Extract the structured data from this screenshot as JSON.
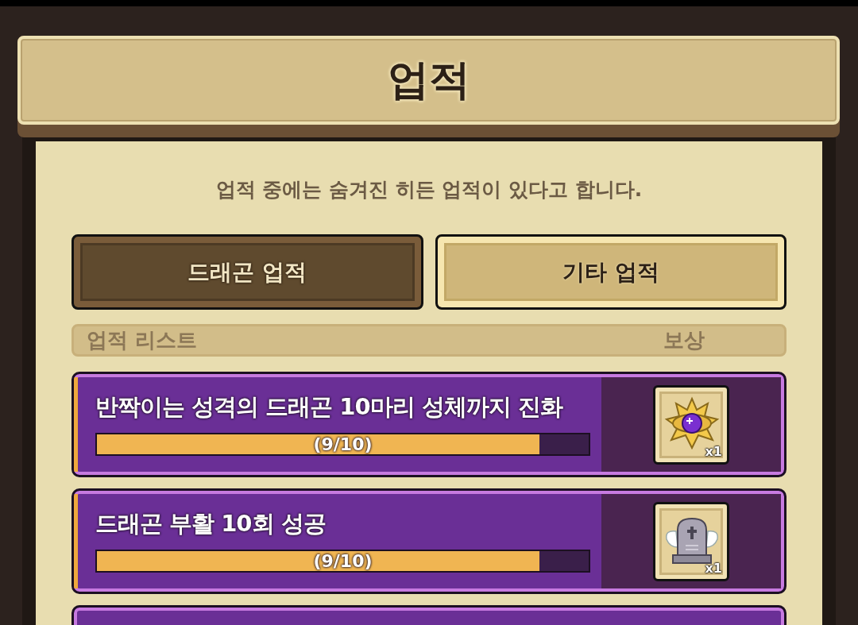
{
  "title": "업적",
  "notice": "업적 중에는 숨겨진 히든 업적이 있다고 합니다.",
  "tabs": [
    {
      "label": "드래곤 업적",
      "selected": true
    },
    {
      "label": "기타 업적",
      "selected": false
    }
  ],
  "list_header": {
    "column_1": "업적 리스트",
    "column_2": "보상"
  },
  "achievements": [
    {
      "name": "반짝이는 성격의 드래곤 10마리 성체까지 진화",
      "level": 0.9,
      "progress": "(9/10)",
      "reward": {
        "kind": "gem",
        "quantity": "x1"
      }
    },
    {
      "name": "드래곤 부활 10회 성공",
      "level": 0.9,
      "progress": "(9/10)",
      "reward": {
        "kind": "tombstone",
        "quantity": "x1"
      }
    }
  ]
}
